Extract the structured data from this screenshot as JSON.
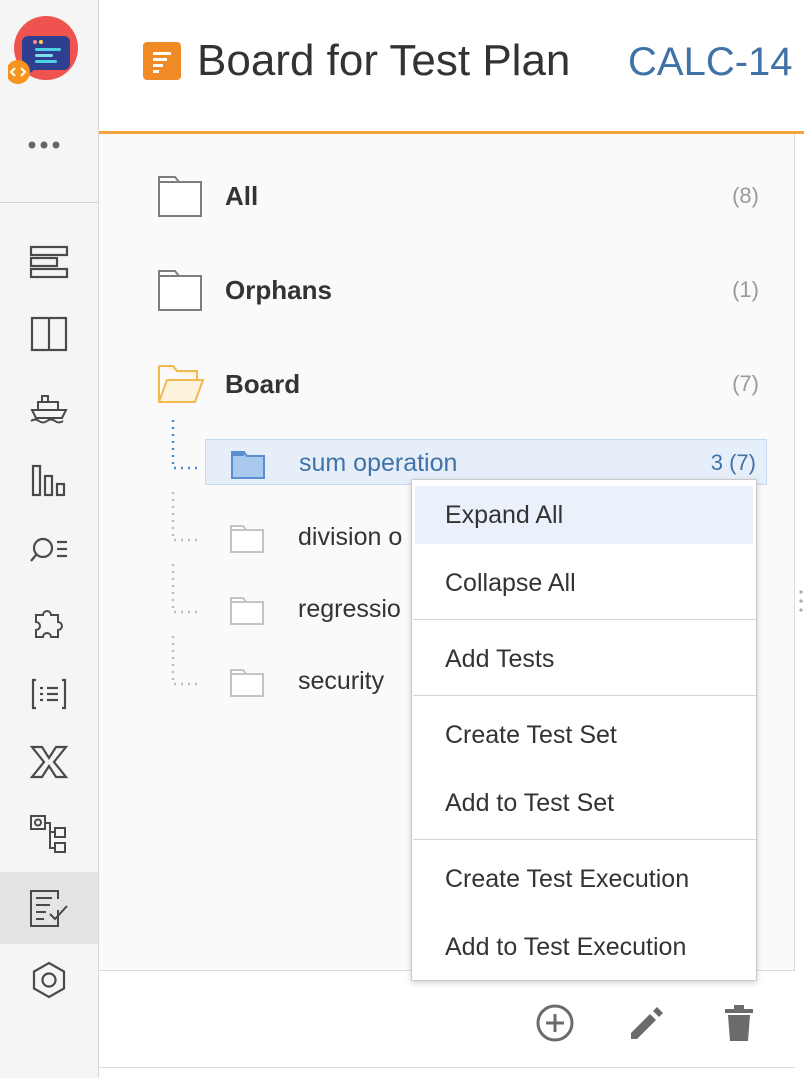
{
  "colors": {
    "accent_orange": "#f3a33a",
    "link_blue": "#3f73a8",
    "selection_bg": "#e6eff9",
    "menu_highlight": "#eaf1fb",
    "folder_open": "#f0b94e",
    "folder_selected": "#6a9fd8",
    "count_gray": "#9a9a9a"
  },
  "sidebar": {
    "logo_icon": "app-logo-icon",
    "more_icon": "more-dots-icon",
    "items": [
      {
        "icon": "backlog-icon"
      },
      {
        "icon": "board-columns-icon"
      },
      {
        "icon": "releases-ship-icon"
      },
      {
        "icon": "reports-bar-chart-icon"
      },
      {
        "icon": "search-list-icon"
      },
      {
        "icon": "puzzle-icon"
      },
      {
        "icon": "test-list-icon"
      },
      {
        "icon": "xray-icon"
      },
      {
        "icon": "hierarchy-icon"
      },
      {
        "icon": "test-plan-board-icon",
        "active": true
      },
      {
        "icon": "settings-hexagon-icon"
      }
    ]
  },
  "header": {
    "title": "Board for Test Plan",
    "issue_key": "CALC-14"
  },
  "tree": {
    "folders": [
      {
        "label": "All",
        "count": "(8)"
      },
      {
        "label": "Orphans",
        "count": "(1)"
      },
      {
        "label": "Board",
        "count": "(7)"
      }
    ],
    "children": [
      {
        "label": "sum operation",
        "count": "3 (7)",
        "selected": true
      },
      {
        "label": "division o",
        "count": ""
      },
      {
        "label": "regressio",
        "count": ""
      },
      {
        "label": "security",
        "count": ""
      }
    ]
  },
  "context_menu": {
    "items": [
      {
        "label": "Expand All",
        "highlighted": true
      },
      {
        "label": "Collapse All"
      },
      {
        "label": "Add Tests"
      },
      {
        "label": "Create Test Set"
      },
      {
        "label": "Add to Test Set"
      },
      {
        "label": "Create Test Execution"
      },
      {
        "label": "Add to Test Execution"
      }
    ]
  },
  "footer": {
    "tools": [
      {
        "icon": "add-circle-icon"
      },
      {
        "icon": "pencil-edit-icon"
      },
      {
        "icon": "trash-icon"
      }
    ]
  }
}
